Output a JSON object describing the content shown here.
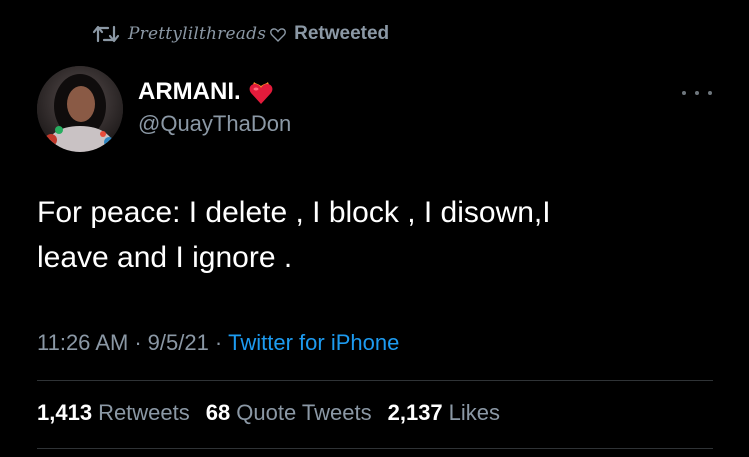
{
  "retweet_bar": {
    "retweeter": "Prettylilthreads",
    "label": "Retweeted"
  },
  "tweet": {
    "display_name": "ARMANI.",
    "handle": "@QuayThaDon",
    "text": "For peace: I delete , I block , I disown,I\nleave and I ignore .",
    "time": "11:26 AM",
    "separator": "·",
    "date": "9/5/21",
    "source": "Twitter for iPhone"
  },
  "stats": {
    "retweets_count": "1,413",
    "retweets_label": "Retweets",
    "quotes_count": "68",
    "quotes_label": "Quote Tweets",
    "likes_count": "2,137",
    "likes_label": "Likes"
  },
  "icons": {
    "retweet": "retweet-icon",
    "heart_outline": "heart-outline-icon",
    "heart_fire_emoji": "heart-on-fire-emoji",
    "more": "more-options-icon"
  },
  "colors": {
    "background": "#000000",
    "primary_text": "#ffffff",
    "secondary_text": "#8b98a5",
    "link": "#1d9bf0",
    "divider": "#2f3336"
  }
}
